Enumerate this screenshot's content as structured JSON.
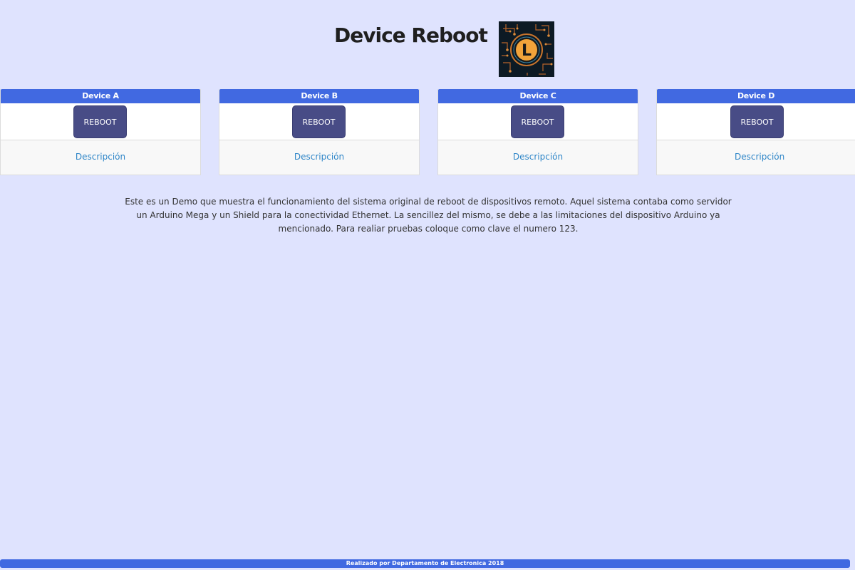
{
  "header": {
    "title": "Device Reboot",
    "logo_icon": "circuit-letter-l-logo",
    "logo_letter": "L"
  },
  "colors": {
    "background": "#dfe3fe",
    "accent": "#4169e1",
    "button": "#484c86",
    "link": "#2f86c8"
  },
  "devices": [
    {
      "name": "Device A",
      "button_label": "REBOOT",
      "link_label": "Descripción"
    },
    {
      "name": "Device B",
      "button_label": "REBOOT",
      "link_label": "Descripción"
    },
    {
      "name": "Device C",
      "button_label": "REBOOT",
      "link_label": "Descripción"
    },
    {
      "name": "Device D",
      "button_label": "REBOOT",
      "link_label": "Descripción"
    }
  ],
  "intro": {
    "text": "Este es un Demo que muestra el funcionamiento del sistema original de reboot de dispositivos remoto. Aquel sistema contaba como servidor un Arduino Mega y un Shield para la conectividad Ethernet. La sencillez del mismo, se debe a las limitaciones del dispositivo Arduino ya mencionado. Para realiar pruebas coloque como clave el numero 123."
  },
  "footer": {
    "text": "Realizado por Departamento de Electronica 2018"
  }
}
